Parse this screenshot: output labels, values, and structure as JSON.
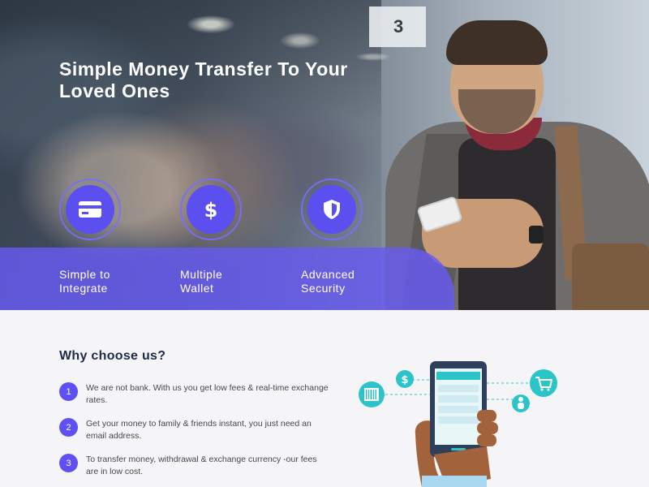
{
  "hero": {
    "title": "Simple Money Transfer To Your Loved Ones",
    "features": [
      {
        "label_line1": "Simple to",
        "label_line2": "Integrate",
        "icon": "credit-card-icon"
      },
      {
        "label_line1": "Multiple",
        "label_line2": "Wallet",
        "icon": "dollar-icon"
      },
      {
        "label_line1": "Advanced",
        "label_line2": "Security",
        "icon": "shield-icon"
      }
    ],
    "sign_text": "3"
  },
  "why": {
    "title": "Why choose us?",
    "reasons": [
      {
        "num": "1",
        "text": "We are not bank. With us you get low fees & real-time exchange rates."
      },
      {
        "num": "2",
        "text": "Get your money to family & friends instant, you just need an email address."
      },
      {
        "num": "3",
        "text": "To transfer money, withdrawal & exchange currency -our fees are in low cost."
      }
    ]
  },
  "colors": {
    "accent": "#5e50f2",
    "band": "#675af3",
    "heading": "#1e2a4a",
    "teal": "#2bc4c9"
  }
}
